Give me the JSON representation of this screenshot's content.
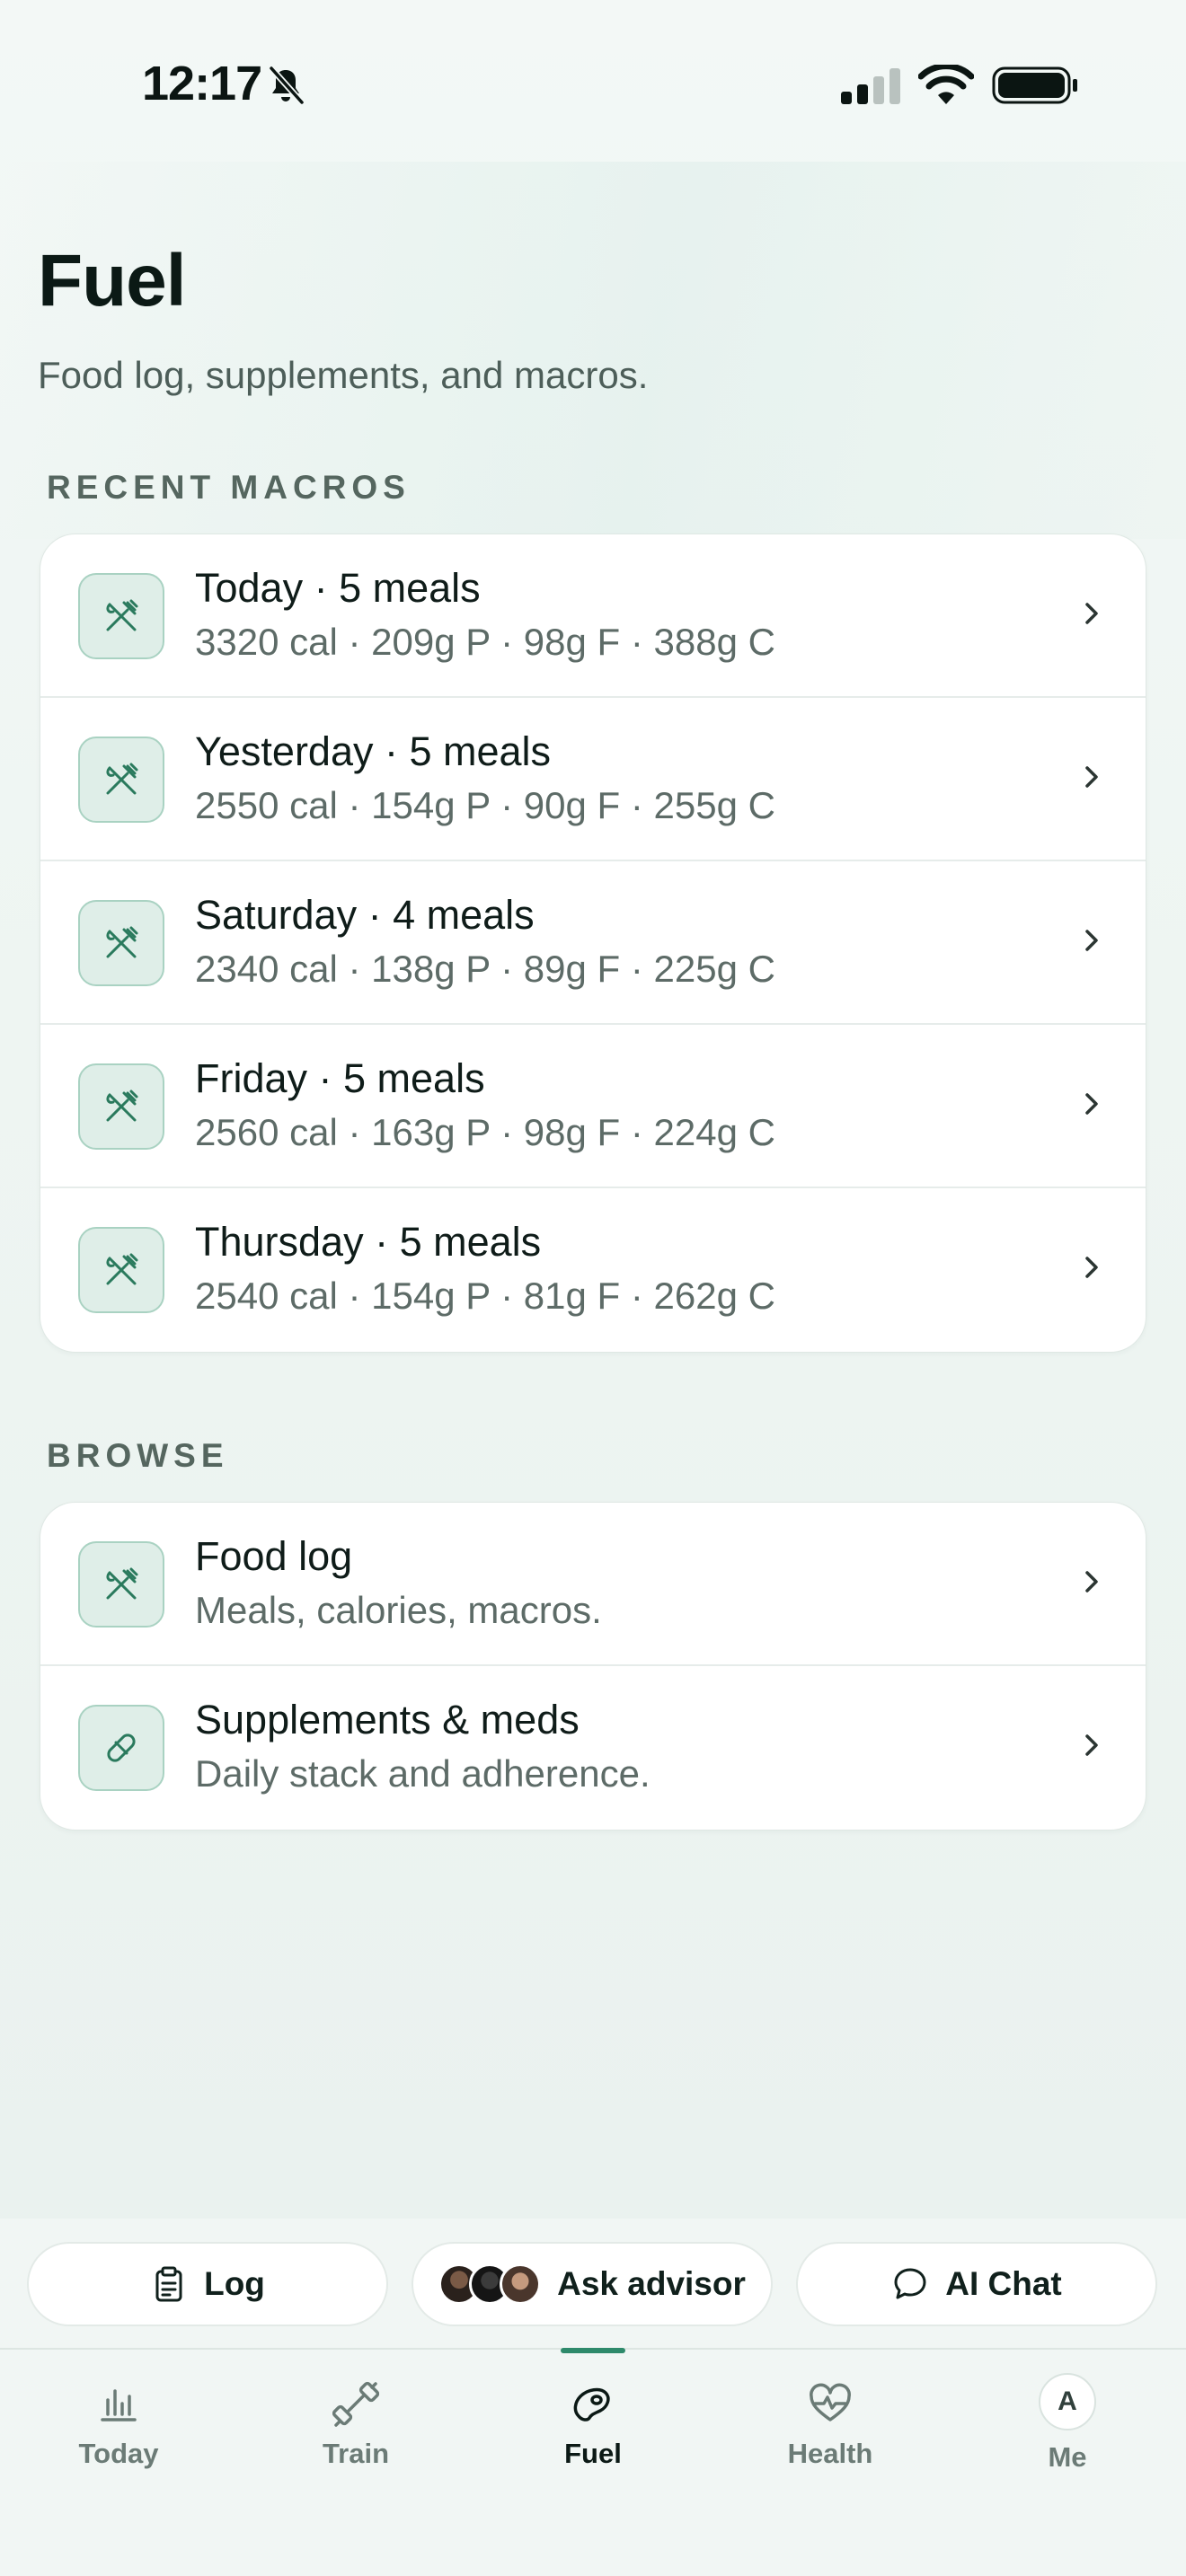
{
  "status_bar": {
    "time": "12:17"
  },
  "header": {
    "title": "Fuel",
    "subtitle": "Food log, supplements, and macros."
  },
  "recent_macros": {
    "label": "RECENT MACROS",
    "items": [
      {
        "title": "Today · 5 meals",
        "detail": "3320 cal · 209g P · 98g F · 388g C",
        "icon": "fork-knife-icon"
      },
      {
        "title": "Yesterday · 5 meals",
        "detail": "2550 cal · 154g P · 90g F · 255g C",
        "icon": "fork-knife-icon"
      },
      {
        "title": "Saturday · 4 meals",
        "detail": "2340 cal · 138g P · 89g F · 225g C",
        "icon": "fork-knife-icon"
      },
      {
        "title": "Friday · 5 meals",
        "detail": "2560 cal · 163g P · 98g F · 224g C",
        "icon": "fork-knife-icon"
      },
      {
        "title": "Thursday · 5 meals",
        "detail": "2540 cal · 154g P · 81g F · 262g C",
        "icon": "fork-knife-icon"
      }
    ]
  },
  "browse": {
    "label": "BROWSE",
    "items": [
      {
        "title": "Food log",
        "detail": "Meals, calories, macros.",
        "icon": "fork-knife-icon"
      },
      {
        "title": "Supplements & meds",
        "detail": "Daily stack and adherence.",
        "icon": "pill-icon"
      }
    ]
  },
  "actions": {
    "log_label": "Log",
    "ask_advisor_label": "Ask advisor",
    "ai_chat_label": "AI Chat"
  },
  "tabs": [
    {
      "label": "Today",
      "icon": "chart-bars-icon",
      "active": false
    },
    {
      "label": "Train",
      "icon": "dumbbell-icon",
      "active": false
    },
    {
      "label": "Fuel",
      "icon": "steak-icon",
      "active": true
    },
    {
      "label": "Health",
      "icon": "heart-pulse-icon",
      "active": false
    },
    {
      "label": "Me",
      "icon": "avatar",
      "active": false,
      "initial": "A"
    }
  ],
  "colors": {
    "accent": "#2e8a6b",
    "icon_bg": "#dfeee8",
    "icon_border": "#a9d2c2"
  }
}
